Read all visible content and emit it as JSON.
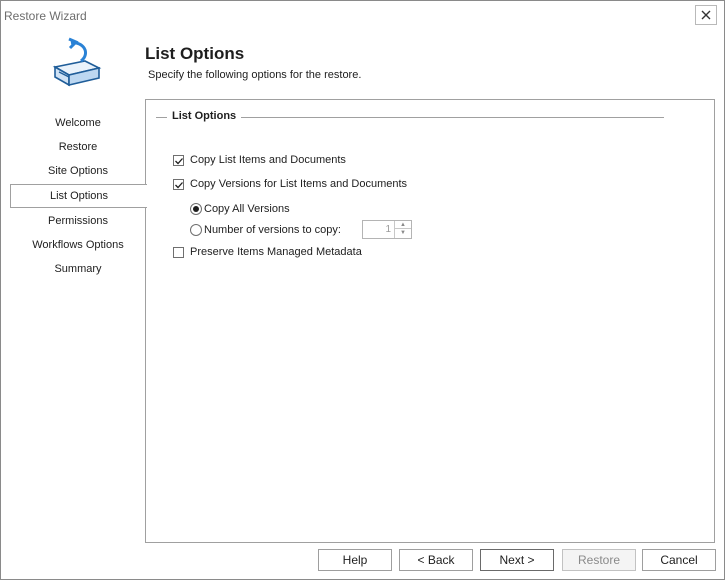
{
  "window": {
    "title": "Restore Wizard"
  },
  "header": {
    "title": "List Options",
    "subtitle": "Specify the following options for the restore."
  },
  "nav": {
    "items": [
      {
        "label": "Welcome",
        "active": false
      },
      {
        "label": "Restore",
        "active": false
      },
      {
        "label": "Site Options",
        "active": false
      },
      {
        "label": "List Options",
        "active": true
      },
      {
        "label": "Permissions",
        "active": false
      },
      {
        "label": "Workflows Options",
        "active": false
      },
      {
        "label": "Summary",
        "active": false
      }
    ]
  },
  "list_options": {
    "group_title": "List Options",
    "copy_list_items": {
      "label": "Copy List Items and Documents",
      "checked": true
    },
    "copy_versions": {
      "label": "Copy Versions for List Items and  Documents",
      "checked": true
    },
    "copy_all_versions": {
      "label": "Copy All Versions",
      "selected": true
    },
    "number_of_versions": {
      "label": "Number of versions to copy:",
      "selected": false,
      "value": "1"
    },
    "preserve_metadata": {
      "label": "Preserve Items Managed Metadata",
      "checked": false
    }
  },
  "footer": {
    "help": "Help",
    "back": "< Back",
    "next": "Next >",
    "restore": "Restore",
    "cancel": "Cancel"
  }
}
